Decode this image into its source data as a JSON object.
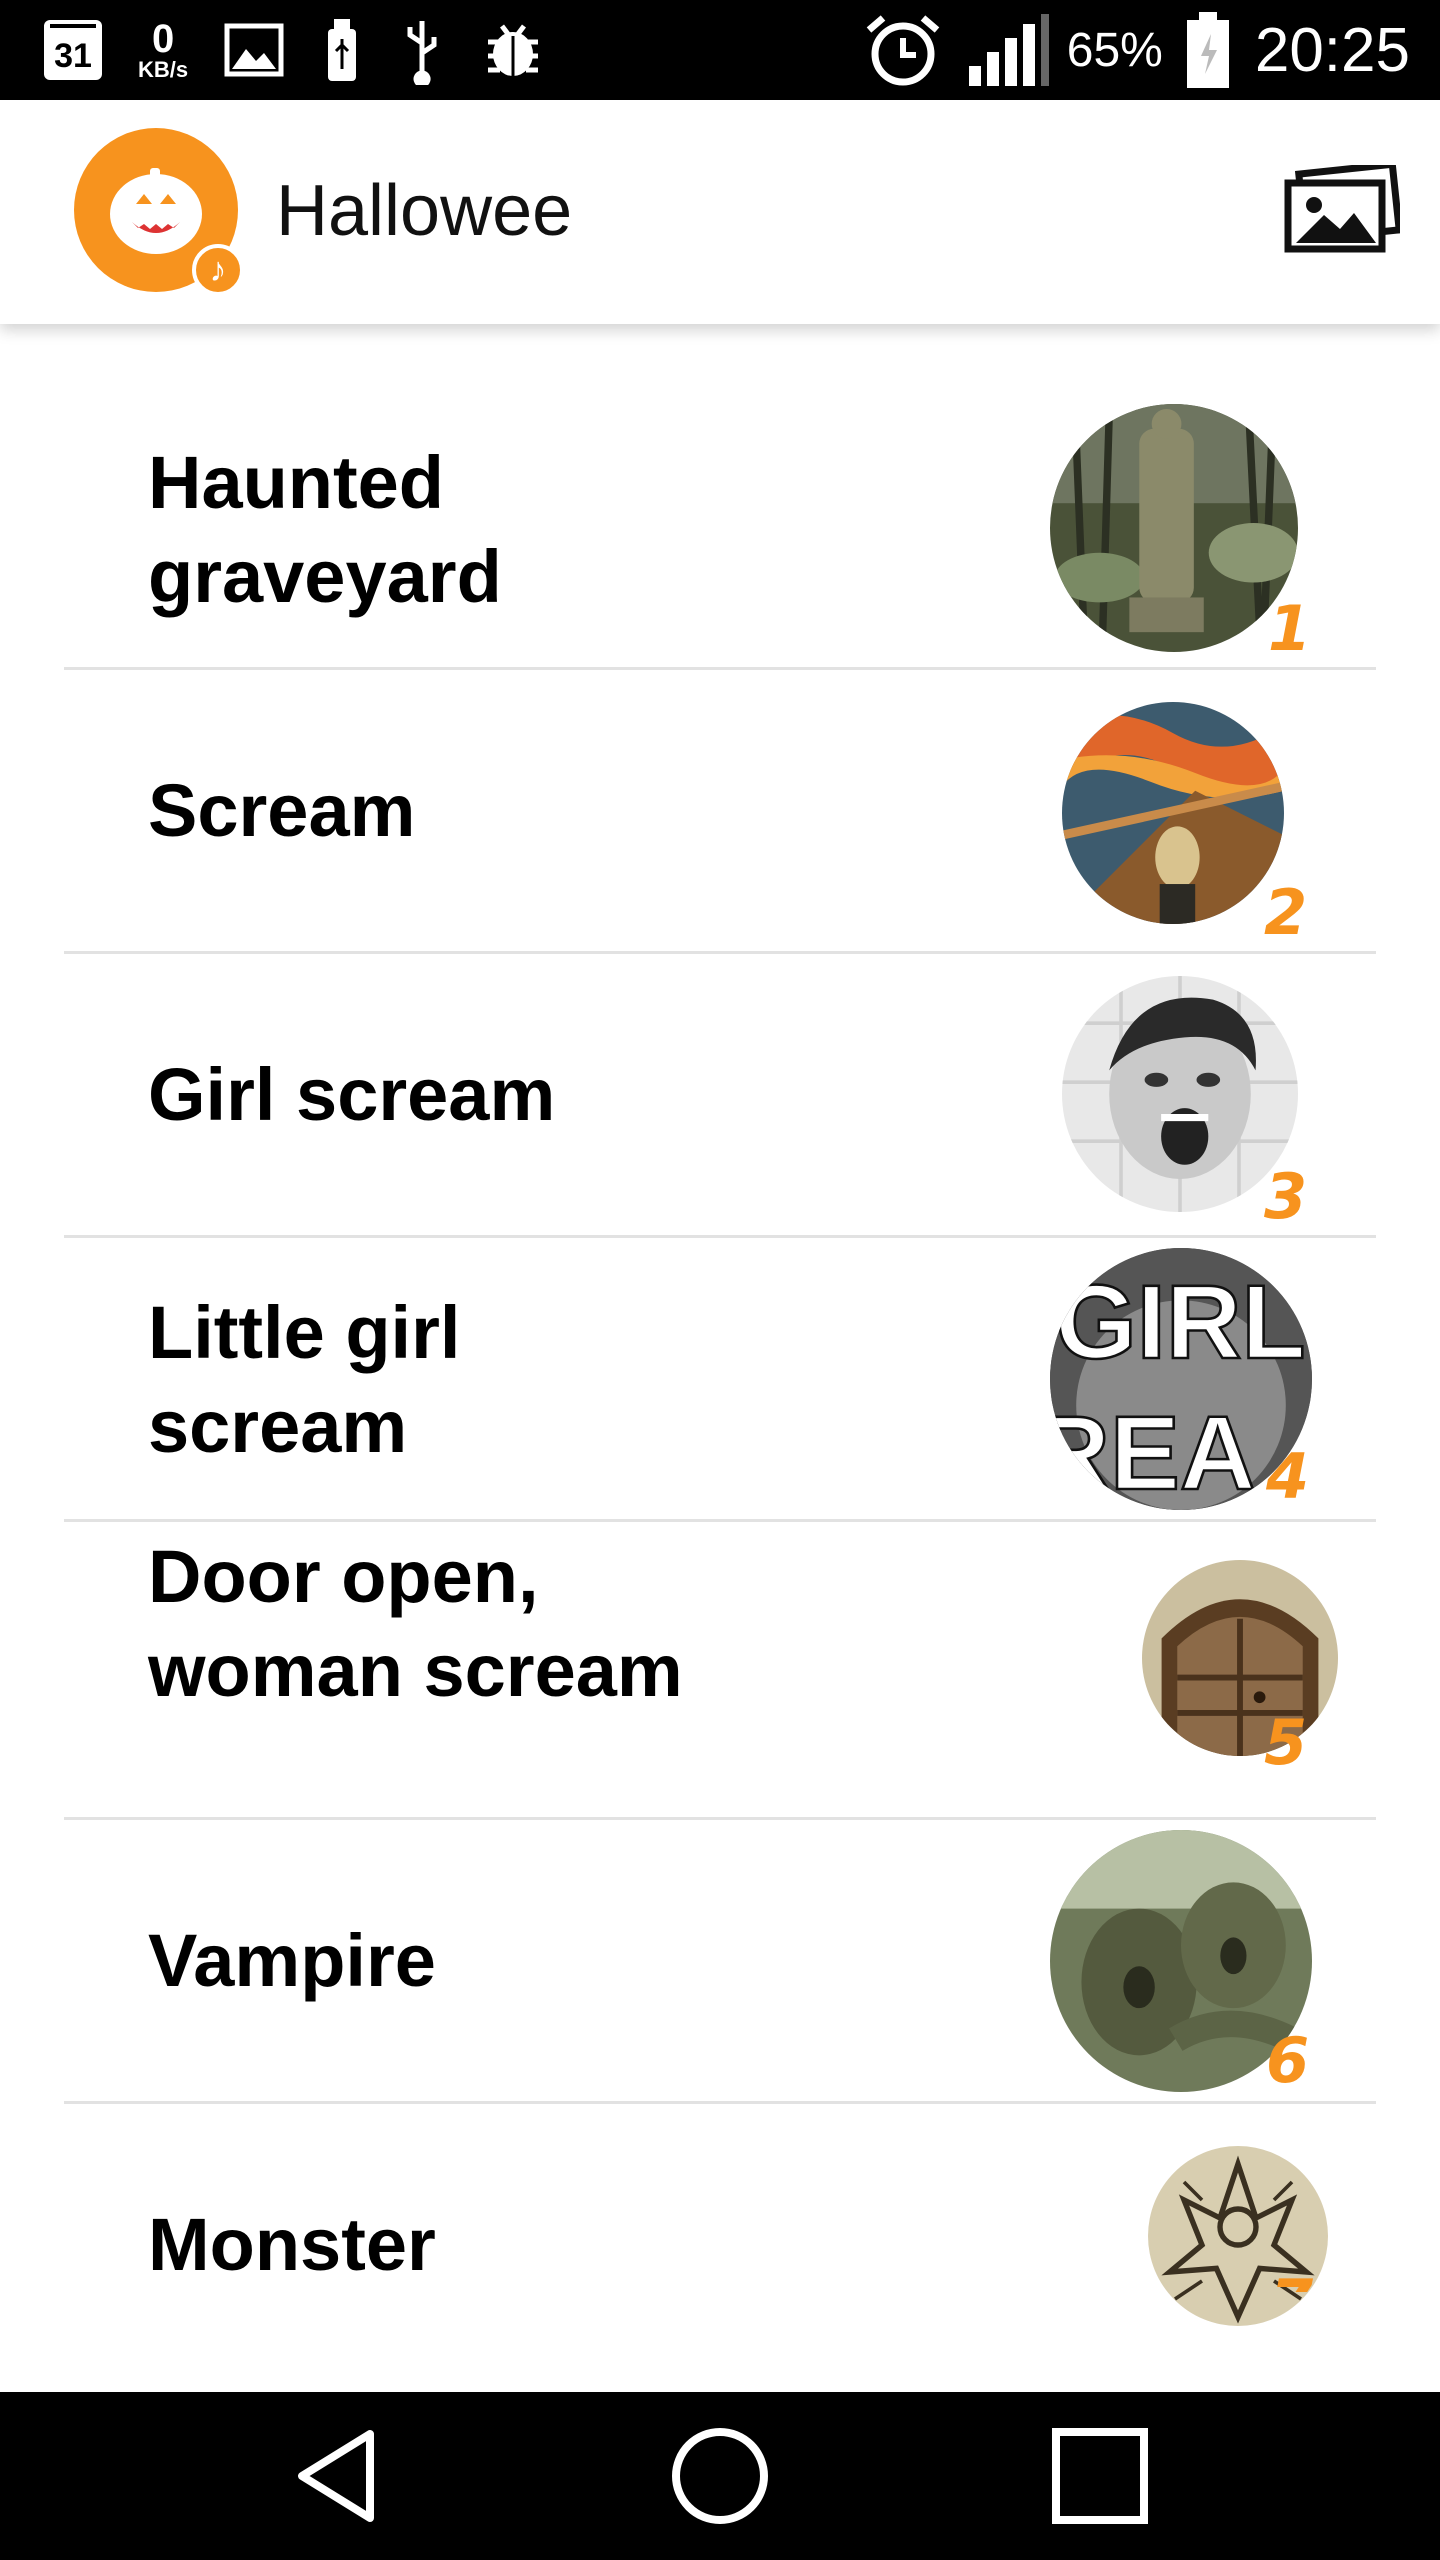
{
  "status_bar": {
    "calendar_day": "31",
    "net_speed": "0",
    "net_speed_unit": "KB/s",
    "battery_percent": "65%",
    "time": "20:25",
    "icons": [
      "calendar-icon",
      "image-icon",
      "usb-icon",
      "usb-debug-icon",
      "bug-icon",
      "alarm-icon",
      "signal-icon",
      "battery-icon"
    ]
  },
  "app_bar": {
    "title": "Hallowee",
    "logo_icon": "pumpkin-icon",
    "action_icon": "gallery-icon"
  },
  "sounds": [
    {
      "label": "Haunted graveyard",
      "number": "1"
    },
    {
      "label": "Scream",
      "number": "2"
    },
    {
      "label": "Girl scream",
      "number": "3"
    },
    {
      "label": "Little girl scream",
      "number": "4"
    },
    {
      "label": "Door open, woman scream",
      "number": "5"
    },
    {
      "label": "Vampire",
      "number": "6"
    },
    {
      "label": "Monster",
      "number": "7"
    }
  ],
  "thumb_text": [
    "GIRL",
    "REA"
  ],
  "colors": {
    "accent": "#f7931e",
    "status_bar": "#000000",
    "nav_bar": "#000000",
    "divider": "#e2e2e2"
  },
  "nav_bar": {
    "icons": [
      "back-icon",
      "home-icon",
      "recents-icon"
    ]
  }
}
